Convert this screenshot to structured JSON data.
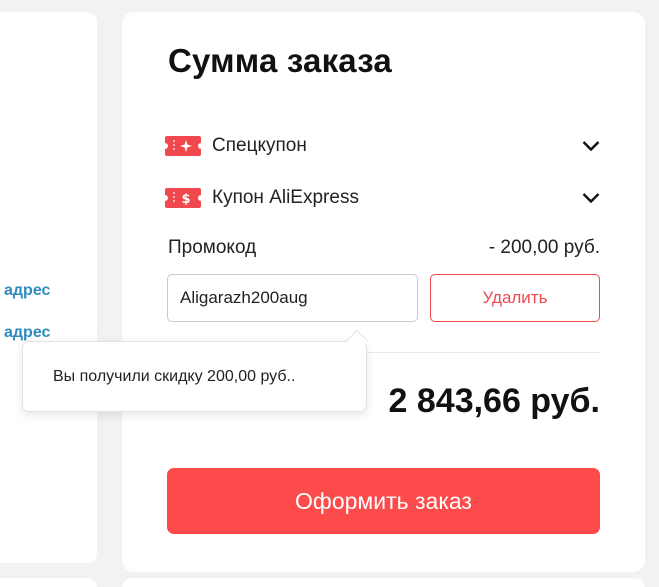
{
  "left_panel": {
    "link_1": "адрес",
    "link_2": "адрес"
  },
  "summary": {
    "title": "Сумма заказа",
    "coupons": [
      {
        "label": "Спецкупон",
        "icon": "special-coupon-icon"
      },
      {
        "label": "Купон AliExpress",
        "icon": "aliexpress-coupon-icon"
      }
    ],
    "promo_label": "Промокод",
    "promo_discount": "- 200,00 руб.",
    "promo_code_value": "Aligarazh200aug",
    "delete_label": "Удалить",
    "total": "2 843,66 руб.",
    "checkout_label": "Оформить заказ"
  },
  "tooltip": {
    "text": "Вы получили скидку 200,00 руб.."
  },
  "colors": {
    "accent_red": "#fd4a4b",
    "link_blue": "#2f8cbe",
    "coupon_icon_red": "#f0484e"
  }
}
